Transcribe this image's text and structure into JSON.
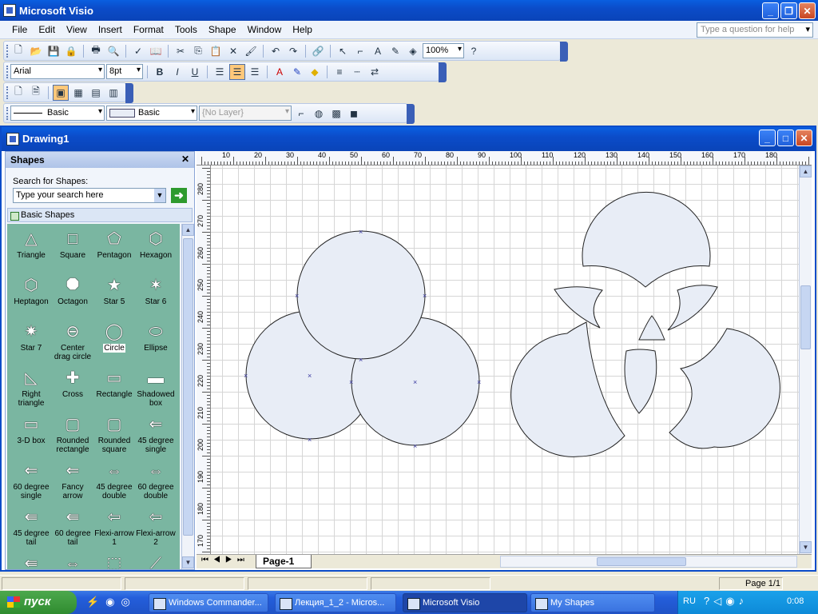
{
  "app": {
    "title": "Microsoft Visio"
  },
  "menu": {
    "items": [
      {
        "label": "File",
        "accel": "F"
      },
      {
        "label": "Edit",
        "accel": "E"
      },
      {
        "label": "View",
        "accel": "V"
      },
      {
        "label": "Insert",
        "accel": "I"
      },
      {
        "label": "Format",
        "accel": "o"
      },
      {
        "label": "Tools",
        "accel": "T"
      },
      {
        "label": "Shape",
        "accel": "S"
      },
      {
        "label": "Window",
        "accel": "W"
      },
      {
        "label": "Help",
        "accel": "H"
      }
    ],
    "ask_placeholder": "Type a question for help"
  },
  "toolbar": {
    "zoom": "100%",
    "font": "Arial",
    "font_size": "8pt",
    "line_style": "Basic",
    "fill_style": "Basic",
    "layer": "{No Layer}"
  },
  "document": {
    "title": "Drawing1"
  },
  "shapes_pane": {
    "title": "Shapes",
    "search_label": "Search for Shapes:",
    "search_placeholder": "Type your search here",
    "stencil": "Basic Shapes",
    "items": [
      "Triangle",
      "Square",
      "Pentagon",
      "Hexagon",
      "Heptagon",
      "Octagon",
      "Star 5",
      "Star 6",
      "Star 7",
      "Center drag circle",
      "Circle",
      "Ellipse",
      "Right triangle",
      "Cross",
      "Rectangle",
      "Shadowed box",
      "3-D box",
      "Rounded rectangle",
      "Rounded square",
      "45 degree single",
      "60 degree single",
      "Fancy arrow",
      "45 degree double",
      "60 degree double",
      "45 degree tail",
      "60 degree tail",
      "Flexi-arrow 1",
      "Flexi-arrow 2",
      "",
      "",
      "",
      ""
    ]
  },
  "rulers": {
    "horizontal": [
      "10",
      "20",
      "30",
      "40",
      "50",
      "60",
      "70",
      "80",
      "90",
      "100",
      "110",
      "120",
      "130",
      "140",
      "150",
      "160",
      "170",
      "180"
    ],
    "vertical": [
      "280",
      "270",
      "260",
      "250",
      "240",
      "230",
      "220",
      "210",
      "200",
      "190",
      "180",
      "170"
    ]
  },
  "page_tab": "Page-1",
  "status": {
    "page": "Page 1/1"
  },
  "taskbar": {
    "start": "пуск",
    "tasks": [
      {
        "label": "Windows Commander...",
        "active": false
      },
      {
        "label": "Лекция_1_2 - Micros...",
        "active": false
      },
      {
        "label": "Microsoft Visio",
        "active": true
      },
      {
        "label": "My Shapes",
        "active": false
      }
    ],
    "lang": "RU",
    "time": "0:08"
  },
  "colors": {
    "shape_fill": "#e8edf6",
    "grid": "#d6d6d6",
    "stencil_bg": "#7ab6a1",
    "xp_blue": "#0b4cc9"
  }
}
